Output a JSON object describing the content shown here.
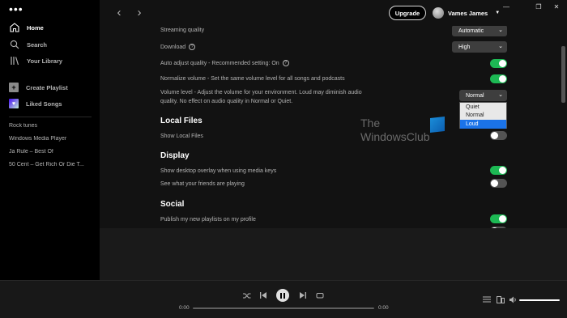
{
  "sidebar": {
    "menu_glyph": "•••",
    "nav": [
      {
        "label": "Home",
        "icon": "home-icon"
      },
      {
        "label": "Search",
        "icon": "search-icon"
      },
      {
        "label": "Your Library",
        "icon": "library-icon"
      }
    ],
    "actions": [
      {
        "label": "Create Playlist",
        "icon": "plus-icon"
      },
      {
        "label": "Liked Songs",
        "icon": "heart-icon"
      }
    ],
    "playlists": [
      "Rock tunes",
      "Windows Media Player",
      "Ja Rule – Best Of",
      "50 Cent – Get Rich Or Die T..."
    ]
  },
  "topbar": {
    "upgrade_label": "Upgrade",
    "user_name": "Vames James"
  },
  "settings": {
    "streaming_quality": {
      "label": "Streaming quality",
      "value": "Automatic"
    },
    "download": {
      "label": "Download",
      "value": "High"
    },
    "auto_adjust": {
      "label": "Auto adjust quality - Recommended setting: On",
      "on": true
    },
    "normalize": {
      "label": "Normalize volume - Set the same volume level for all songs and podcasts",
      "on": true
    },
    "volume_level": {
      "label_line1": "Volume level - Adjust the volume for your environment. Loud may diminish audio",
      "label_line2": "quality. No effect on audio quality in Normal or Quiet.",
      "value": "Normal",
      "options": [
        "Quiet",
        "Normal",
        "Loud"
      ],
      "highlighted": "Loud"
    },
    "local_files": {
      "heading": "Local Files",
      "show_label": "Show Local Files",
      "on": false
    },
    "display": {
      "heading": "Display",
      "overlay_label": "Show desktop overlay when using media keys",
      "overlay_on": true,
      "friends_label": "See what your friends are playing",
      "friends_on": false
    },
    "social": {
      "heading": "Social",
      "publish_label": "Publish my new playlists on my profile",
      "publish_on": true
    }
  },
  "watermark": {
    "line1": "The",
    "line2": "WindowsClub"
  },
  "player": {
    "elapsed": "0:00",
    "duration": "0:00",
    "progress": 0,
    "volume": 1.0
  },
  "colors": {
    "accent": "#1db954",
    "background": "#121212",
    "sidebar": "#000000"
  }
}
